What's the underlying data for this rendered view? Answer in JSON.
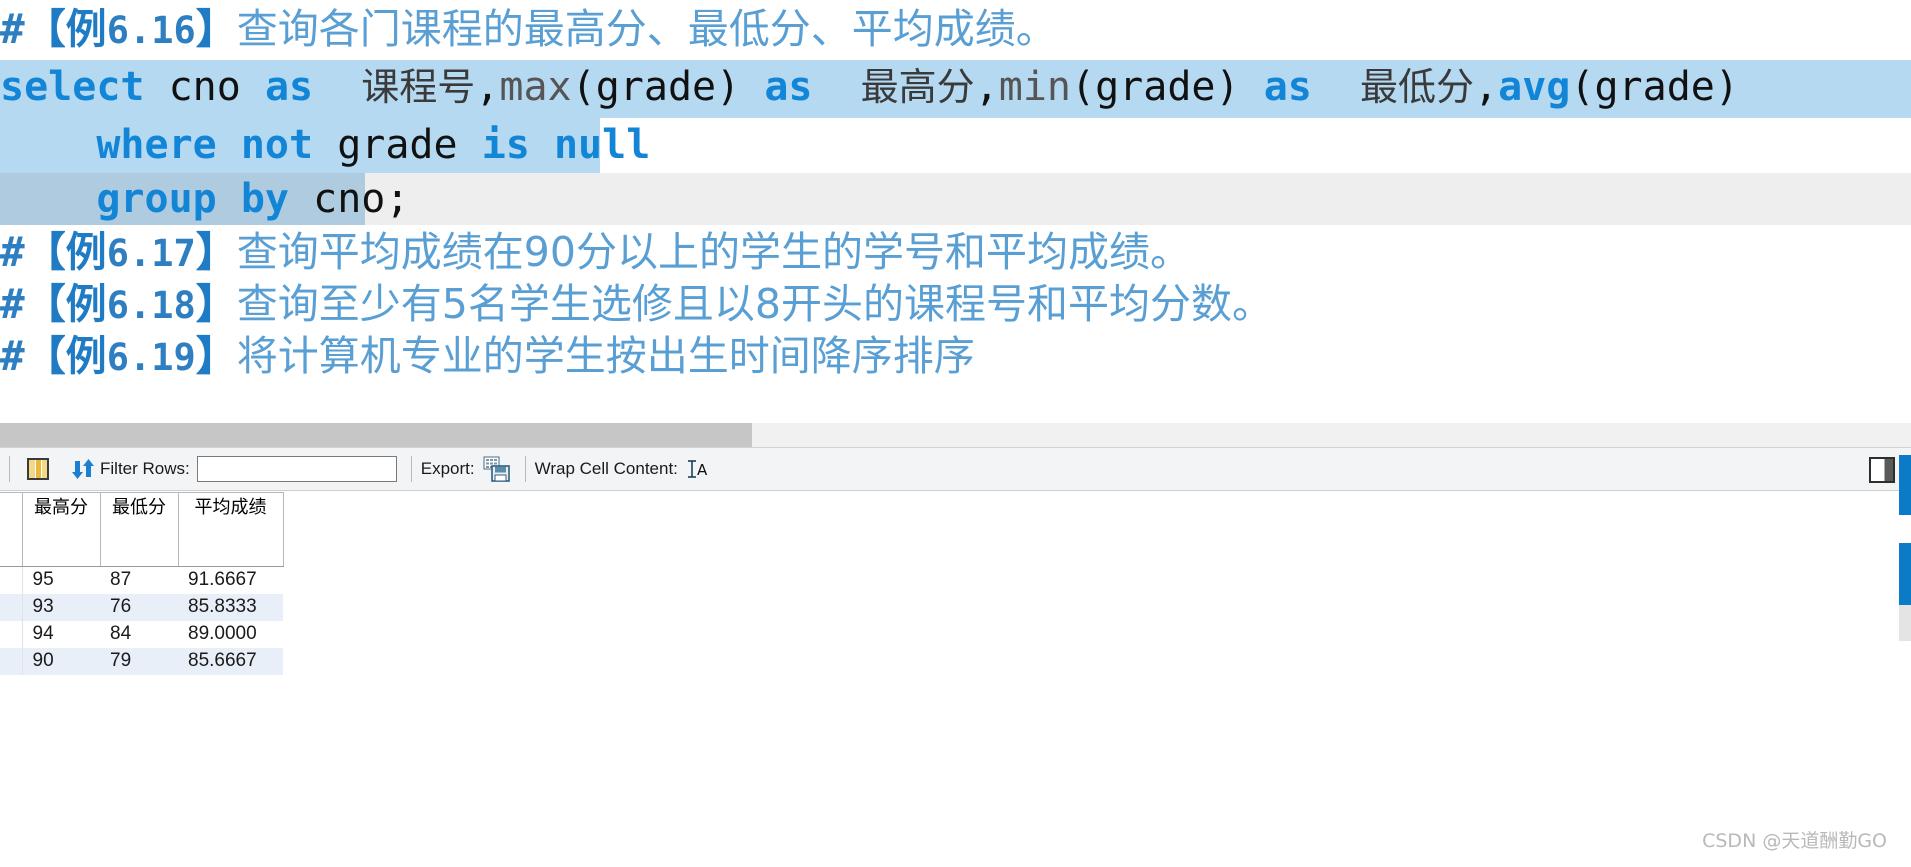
{
  "editor": {
    "lines": [
      {
        "id": "comment-616",
        "hash": "#",
        "bracket_open": "【例",
        "number": "6.16",
        "bracket_close": "】",
        "text": "查询各门课程的最高分、最低分、平均成绩。"
      },
      {
        "id": "sql-select",
        "text": "select cno as 课程号,max(grade) as 最高分,min(grade) as 最低分,avg(grade)",
        "tokens": [
          "select",
          " cno ",
          "as",
          " 课程号,",
          "max",
          "(grade)",
          " ",
          "as",
          " 最高分,",
          "min",
          "(grade)",
          " ",
          "as",
          " 最低分,",
          "avg",
          "(grade)"
        ]
      },
      {
        "id": "sql-where",
        "text": "    where not grade is null"
      },
      {
        "id": "sql-groupby",
        "text": "    group by cno;"
      },
      {
        "id": "comment-617",
        "hash": "#",
        "bracket_open": "【例",
        "number": "6.17",
        "bracket_close": "】",
        "text": "查询平均成绩在90分以上的学生的学号和平均成绩。"
      },
      {
        "id": "comment-618",
        "hash": "#",
        "bracket_open": "【例",
        "number": "6.18",
        "bracket_close": "】",
        "text": "查询至少有5名学生选修且以8开头的课程号和平均分数。"
      },
      {
        "id": "comment-619",
        "hash": "#",
        "bracket_open": "【例",
        "number": "6.19",
        "bracket_close": "】",
        "text": "将计算机专业的学生按出生时间降序排序"
      }
    ]
  },
  "toolbar": {
    "grid_icon": "grid-columns-icon",
    "refresh_icon": "refresh-icon",
    "filter_rows_label": "Filter Rows:",
    "filter_value": "",
    "filter_placeholder": "",
    "export_label": "Export:",
    "export_icon": "save-export-icon",
    "wrap_label": "Wrap Cell Content:",
    "wrap_icon": "wrap-cell-content-icon",
    "panel_toggle_icon": "toggle-side-panel-icon"
  },
  "result_grid": {
    "columns": [
      {
        "key": "max",
        "label": "最高分"
      },
      {
        "key": "min",
        "label": "最低分"
      },
      {
        "key": "avg",
        "label": "平均成绩"
      }
    ],
    "rows": [
      {
        "max": "95",
        "min": "87",
        "avg": "91.6667"
      },
      {
        "max": "93",
        "min": "76",
        "avg": "85.8333"
      },
      {
        "max": "94",
        "min": "84",
        "avg": "89.0000"
      },
      {
        "max": "90",
        "min": "79",
        "avg": "85.6667"
      }
    ]
  },
  "watermark": {
    "text": "CSDN @天道酬勤GO"
  },
  "colors": {
    "keyword_blue": "#1285d6",
    "comment_blue": "#5a9fd4",
    "selection_light": "#b6d9f2",
    "selection_dark": "#aecbe0",
    "scrollbar_blue": "#0b7bc8",
    "toolbar_bg": "#f3f4f5",
    "alt_row": "#e9eff8"
  }
}
